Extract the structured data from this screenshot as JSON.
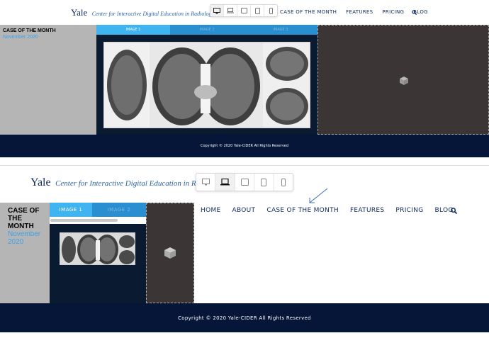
{
  "view1": {
    "logo": {
      "yale": "Yale",
      "subtitle": "Center for Interactive Digital Education in Radiology"
    },
    "nav": [
      "CASE OF THE MONTH",
      "FEATURES",
      "PRICING",
      "BLOG"
    ],
    "case_label": "CASE OF THE MONTH",
    "case_month": "November 2020",
    "tabs": [
      "IMAGE 1",
      "IMAGE 2",
      "IMAGE 3"
    ],
    "footer": "Copyright © 2020 Yale-CIDER All Rights Reserved"
  },
  "view2": {
    "logo": {
      "yale": "Yale",
      "subtitle": "Center for Interactive Digital Education in Radiology"
    },
    "nav": [
      "HOME",
      "ABOUT",
      "CASE OF THE MONTH",
      "FEATURES",
      "PRICING",
      "BLOG"
    ],
    "case_label_lines": [
      "CASE OF",
      "THE",
      "MONTH"
    ],
    "case_month_lines": [
      "November",
      "2020"
    ],
    "tabs": [
      "IMAGE 1",
      "IMAGE 2"
    ],
    "footer": "Copyright © 2020 Yale-CIDER All Rights Reserved"
  },
  "device_toolbar": {
    "icons": [
      "desktop-icon",
      "laptop-icon",
      "tablet-landscape-icon",
      "tablet-portrait-icon",
      "mobile-icon"
    ],
    "active_view1": 0,
    "active_view2": 1
  },
  "colors": {
    "navy": "#0f2a5c",
    "footer_bg": "#051638",
    "tab_active": "#3fb4f0",
    "tab_bar": "#2a8fd0",
    "month_blue": "#3fa1e8",
    "embed_bg": "#3b3635",
    "case_panel_bg": "#b5b5b5"
  }
}
